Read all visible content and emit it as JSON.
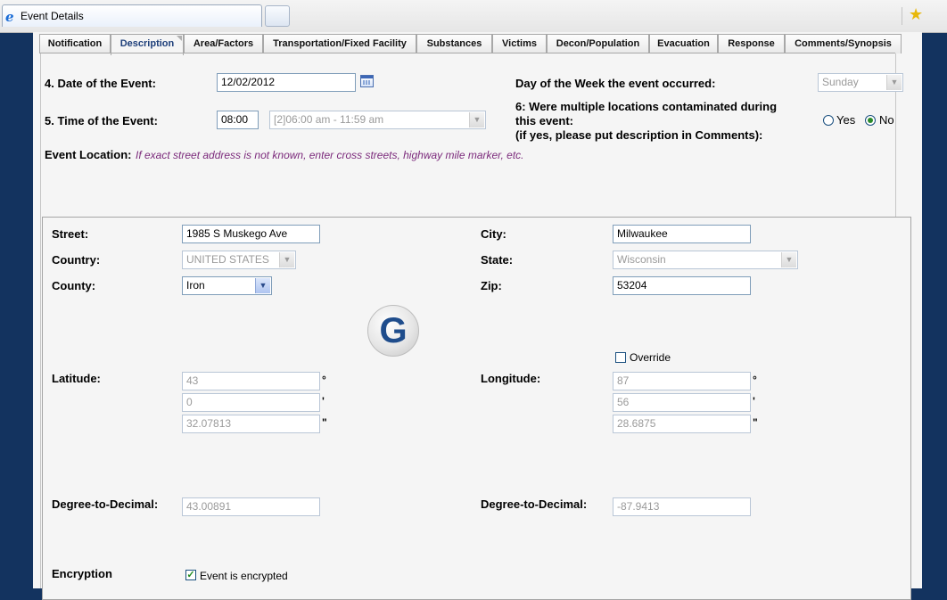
{
  "browser": {
    "tab_title": "Event Details"
  },
  "tabs": [
    {
      "label": "Notification"
    },
    {
      "label": "Description"
    },
    {
      "label": "Area/Factors"
    },
    {
      "label": "Transportation/Fixed Facility"
    },
    {
      "label": "Substances"
    },
    {
      "label": "Victims"
    },
    {
      "label": "Decon/Population"
    },
    {
      "label": "Evacuation"
    },
    {
      "label": "Response"
    },
    {
      "label": "Comments/Synopsis"
    }
  ],
  "active_tab": "Description",
  "form": {
    "date_label": "4. Date of the Event:",
    "date_value": "12/02/2012",
    "time_label": "5. Time of the Event:",
    "time_value": "08:00",
    "time_range": "[2]06:00 am - 11:59 am",
    "dow_label": "Day of the Week the event occurred:",
    "dow_value": "Sunday",
    "multi_label_1": "6: Were multiple locations contaminated during",
    "multi_label_2": "this event:",
    "multi_label_3": "(if yes, please put description in Comments):",
    "yes_label": "Yes",
    "no_label": "No",
    "multi_selected": "No",
    "location_label": "Event Location:",
    "location_note": "If exact street address is not known, enter cross streets, highway mile marker, etc."
  },
  "address": {
    "street_label": "Street:",
    "street_value": "1985 S Muskego Ave",
    "city_label": "City:",
    "city_value": "Milwaukee",
    "country_label": "Country:",
    "country_value": "UNITED STATES",
    "state_label": "State:",
    "state_value": "Wisconsin",
    "county_label": "County:",
    "county_value": "Iron",
    "zip_label": "Zip:",
    "zip_value": "53204",
    "geocode_letter": "G",
    "override_label": "Override",
    "override_checked": false,
    "latitude_label": "Latitude:",
    "lat_deg": "43",
    "lat_min": "0",
    "lat_sec": "32.07813",
    "longitude_label": "Longitude:",
    "lon_deg": "87",
    "lon_min": "56",
    "lon_sec": "28.6875",
    "deg_symbol": "°",
    "min_symbol": "'",
    "sec_symbol": "\"",
    "dtd_label_left": "Degree-to-Decimal:",
    "lat_decimal": "43.00891",
    "dtd_label_right": "Degree-to-Decimal:",
    "lon_decimal": "-87.9413",
    "encryption_label": "Encryption",
    "encrypted_label": "Event is encrypted",
    "encrypted_checked": true
  },
  "colors": {
    "page_background": "#13335f",
    "panel_background": "#f5f5f5",
    "note_text": "#7b2a7b",
    "active_tab_text": "#1e3f7a"
  }
}
